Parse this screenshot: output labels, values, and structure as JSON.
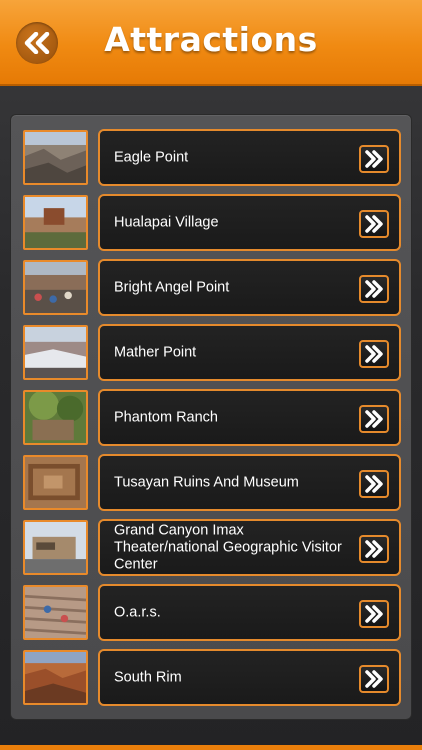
{
  "header": {
    "title": "Attractions",
    "back_icon": "double-chevron-left-icon"
  },
  "colors": {
    "accent": "#f08a12",
    "card_border": "#e58a2c",
    "card_bg": "#1e1e1e",
    "text": "#ffffff"
  },
  "items": [
    {
      "label": "Eagle Point",
      "thumb": "canyon-photo"
    },
    {
      "label": "Hualapai Village",
      "thumb": "village-photo"
    },
    {
      "label": "Bright Angel Point",
      "thumb": "overlook-crowd-photo"
    },
    {
      "label": "Mather Point",
      "thumb": "snowy-canyon-photo"
    },
    {
      "label": "Phantom Ranch",
      "thumb": "ranch-trees-photo"
    },
    {
      "label": "Tusayan Ruins And Museum",
      "thumb": "ruins-photo"
    },
    {
      "label": "Grand Canyon Imax Theater/national Geographic Visitor Center",
      "thumb": "building-photo"
    },
    {
      "label": "O.a.r.s.",
      "thumb": "climbers-photo"
    },
    {
      "label": "South Rim",
      "thumb": "canyon-sunset-photo"
    }
  ]
}
